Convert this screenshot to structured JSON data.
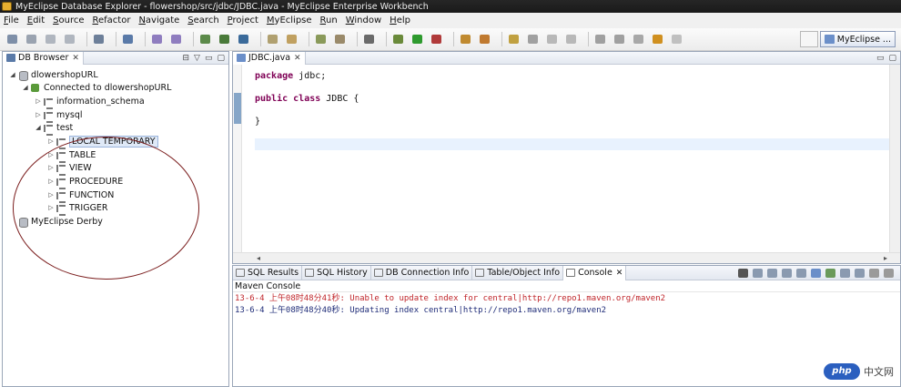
{
  "window": {
    "title": "MyEclipse Database Explorer - flowershop/src/jdbc/JDBC.java - MyEclipse Enterprise Workbench"
  },
  "menu": [
    "File",
    "Edit",
    "Source",
    "Refactor",
    "Navigate",
    "Search",
    "Project",
    "MyEclipse",
    "Run",
    "Window",
    "Help"
  ],
  "perspective": {
    "label": "MyEclipse ..."
  },
  "db_browser": {
    "tab_label": "DB Browser",
    "tree": [
      {
        "label": "dlowershopURL",
        "level": 0,
        "icon": "database-icon",
        "twisty": "expanded"
      },
      {
        "label": "Connected to dlowershopURL",
        "level": 1,
        "icon": "connection-icon",
        "twisty": "expanded"
      },
      {
        "label": "information_schema",
        "level": 2,
        "icon": "schema-icon",
        "twisty": "collapsed"
      },
      {
        "label": "mysql",
        "level": 2,
        "icon": "schema-icon",
        "twisty": "collapsed"
      },
      {
        "label": "test",
        "level": 2,
        "icon": "schema-icon",
        "twisty": "expanded"
      },
      {
        "label": "LOCAL TEMPORARY",
        "level": 3,
        "icon": "table-group-icon",
        "twisty": "collapsed",
        "selected": true
      },
      {
        "label": "TABLE",
        "level": 3,
        "icon": "table-group-icon",
        "twisty": "collapsed"
      },
      {
        "label": "VIEW",
        "level": 3,
        "icon": "table-group-icon",
        "twisty": "collapsed"
      },
      {
        "label": "PROCEDURE",
        "level": 3,
        "icon": "table-group-icon",
        "twisty": "collapsed"
      },
      {
        "label": "FUNCTION",
        "level": 3,
        "icon": "table-group-icon",
        "twisty": "collapsed"
      },
      {
        "label": "TRIGGER",
        "level": 3,
        "icon": "table-group-icon",
        "twisty": "collapsed"
      },
      {
        "label": "MyEclipse Derby",
        "level": 0,
        "icon": "database-icon",
        "twisty": "none"
      }
    ]
  },
  "editor": {
    "tab_label": "JDBC.java",
    "code": {
      "line1_kw": "package",
      "line1_rest": " jdbc;",
      "line2_kw1": "public",
      "line2_kw2": "class",
      "line2_rest": " JDBC {",
      "line3": "}"
    }
  },
  "bottom": {
    "tabs": [
      {
        "label": "SQL Results",
        "active": false
      },
      {
        "label": "SQL History",
        "active": false
      },
      {
        "label": "DB Connection Info",
        "active": false
      },
      {
        "label": "Table/Object Info",
        "active": false
      },
      {
        "label": "Console",
        "active": true
      }
    ],
    "console_title": "Maven Console",
    "lines": [
      {
        "text": "13-6-4 上午08时48分41秒: Unable to update index for central|http://repo1.maven.org/maven2",
        "kind": "error"
      },
      {
        "text": "13-6-4 上午08时48分40秒: Updating index central|http://repo1.maven.org/maven2",
        "kind": "info"
      }
    ]
  },
  "watermark": {
    "logo": "php",
    "text": "中文网"
  },
  "colors": {
    "accent": "#2b5fbf",
    "error": "#c0262b",
    "info": "#1f2c78",
    "annotation_circle": "#7a1c1c"
  }
}
